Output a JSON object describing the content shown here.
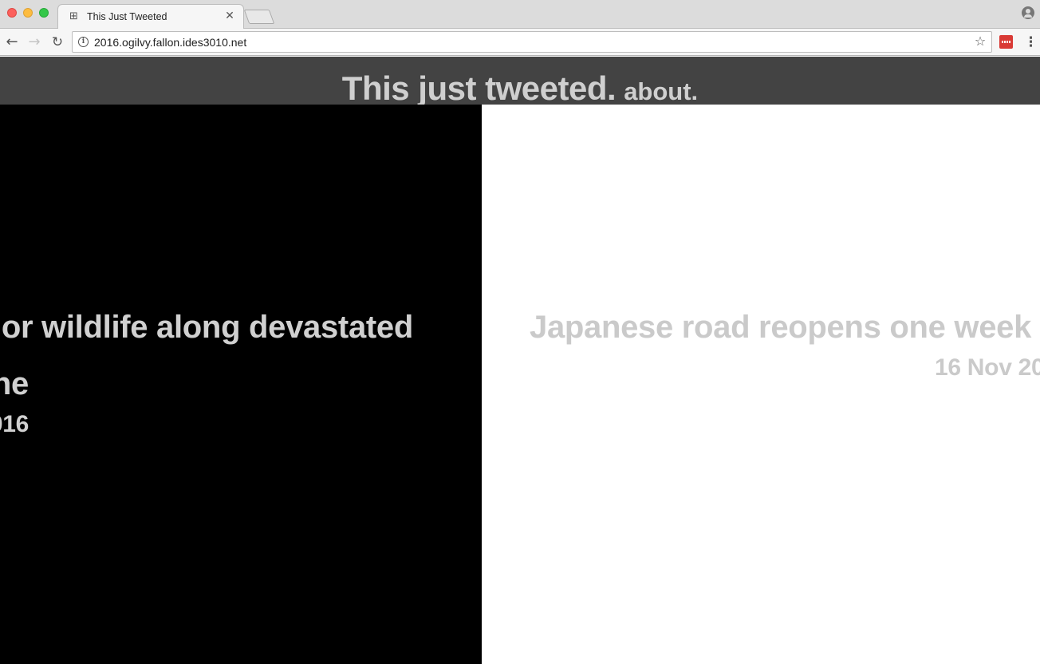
{
  "browser": {
    "tab": {
      "title": "This Just Tweeted",
      "favicon_glyph": "⊞",
      "close_glyph": "✕"
    },
    "toolbar": {
      "back_glyph": "←",
      "forward_glyph": "→",
      "reload_glyph": "↻",
      "url": "2016.ogilvy.fallon.ides3010.net",
      "info_glyph": "i",
      "star_glyph": "☆",
      "menu_glyph": "⋮"
    }
  },
  "site": {
    "title": "This just tweeted.",
    "about_link": "about."
  },
  "panels": {
    "left": {
      "line1": "or wildlife along devastated",
      "line2": "ne",
      "date": "016",
      "background": "#000000"
    },
    "right": {
      "title": "Japanese road reopens one week",
      "date": "16 Nov 20",
      "background": "#ffffff"
    }
  },
  "colors": {
    "header_bg": "#434343",
    "header_text": "#cfcfcf",
    "headline_text": "#d0d0d0"
  }
}
